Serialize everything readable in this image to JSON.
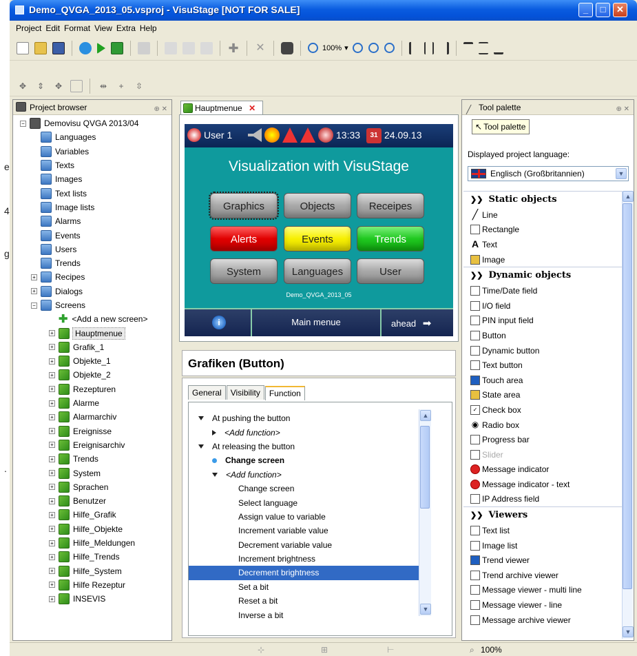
{
  "background_fragments": [
    "e",
    "4",
    "g",
    "."
  ],
  "window": {
    "title": "Demo_QVGA_2013_05.vsproj - VisuStage [NOT FOR SALE]",
    "min": "_",
    "max": "□",
    "close": "✕"
  },
  "menu": [
    "Project",
    "Edit",
    "Format",
    "View",
    "Extra",
    "Help"
  ],
  "toolbar": {
    "zoom": "100%"
  },
  "project_browser": {
    "title": "Project browser",
    "root": "Demovisu QVGA 2013/04",
    "folders": [
      "Languages",
      "Variables",
      "Texts",
      "Images",
      "Text lists",
      "Image lists",
      "Alarms",
      "Events",
      "Users",
      "Trends",
      "Recipes",
      "Dialogs",
      "Screens"
    ],
    "add_screen": "<Add a new screen>",
    "screens": [
      "Hauptmenue",
      "Grafik_1",
      "Objekte_1",
      "Objekte_2",
      "Rezepturen",
      "Alarme",
      "Alarmarchiv",
      "Ereignisse",
      "Ereignisarchiv",
      "Trends",
      "System",
      "Sprachen",
      "Benutzer",
      "Hilfe_Grafik",
      "Hilfe_Objekte",
      "Hilfe_Meldungen",
      "Hilfe_Trends",
      "Hilfe_System",
      "Hilfe Rezeptur",
      "INSEVIS"
    ]
  },
  "editor": {
    "tab": "Hauptmenue",
    "hmi": {
      "user": "User 1",
      "time": "13:33",
      "date": "24.09.13",
      "calendar_day": "31",
      "title": "Visualization with VisuStage",
      "buttons": [
        "Graphics",
        "Objects",
        "Receipes",
        "Alerts",
        "Events",
        "Trends",
        "System",
        "Languages",
        "User"
      ],
      "footer": "Demo_QVGA_2013_05",
      "nav_center": "Main menue",
      "nav_right": "ahead"
    }
  },
  "properties": {
    "heading": "Grafiken (Button)",
    "tabs": [
      "General",
      "Visibility",
      "Function"
    ],
    "items": [
      "At pushing the button",
      "<Add function>",
      "At releasing the button",
      "Change screen",
      "<Add function>",
      "Change screen",
      "Select language",
      "Assign value to variable",
      "Increment variable value",
      "Decrement variable value",
      "Increment brightness",
      "Decrement brightness",
      "Set a bit",
      "Reset a bit",
      "Inverse a bit"
    ]
  },
  "palette": {
    "title": "Tool palette",
    "tooltip": "Tool palette",
    "lang_label": "Displayed project language:",
    "lang_value": "Englisch (Großbritannien)",
    "static_title": "Static objects",
    "static": [
      "Line",
      "Rectangle",
      "Text",
      "Image"
    ],
    "dynamic_title": "Dynamic objects",
    "dynamic": [
      "Time/Date field",
      "I/O field",
      "PIN input field",
      "Button",
      "Dynamic button",
      "Text button",
      "Touch area",
      "State area",
      "Check box",
      "Radio box",
      "Progress bar",
      "Slider",
      "Message indicator",
      "Message indicator - text",
      "IP Address field"
    ],
    "viewers_title": "Viewers",
    "viewers": [
      "Text list",
      "Image list",
      "Trend viewer",
      "Trend archive viewer",
      "Message viewer - multi line",
      "Message viewer - line",
      "Message archive viewer"
    ]
  },
  "status": {
    "zoom": "100%"
  }
}
